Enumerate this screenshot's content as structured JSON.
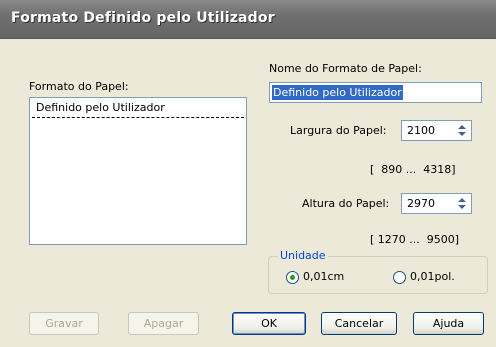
{
  "window": {
    "title": "Formato Definido pelo Utilizador"
  },
  "paper_format": {
    "label": "Formato do Papel:",
    "items": [
      "Definido pelo Utilizador"
    ]
  },
  "paper_name": {
    "label": "Nome do Formato de Papel:",
    "value": "Definido pelo Utilizador"
  },
  "width": {
    "label": "Largura do Papel:",
    "value": "2100",
    "range": "[  890 ...  4318]"
  },
  "height": {
    "label": "Altura do Papel:",
    "value": "2970",
    "range": "[ 1270 ...  9500]"
  },
  "unit": {
    "legend": "Unidade",
    "options": [
      {
        "label": "0,01cm",
        "selected": true
      },
      {
        "label": "0,01pol.",
        "selected": false
      }
    ]
  },
  "buttons": {
    "save": "Gravar",
    "delete": "Apagar",
    "ok": "OK",
    "cancel": "Cancelar",
    "help": "Ajuda"
  }
}
